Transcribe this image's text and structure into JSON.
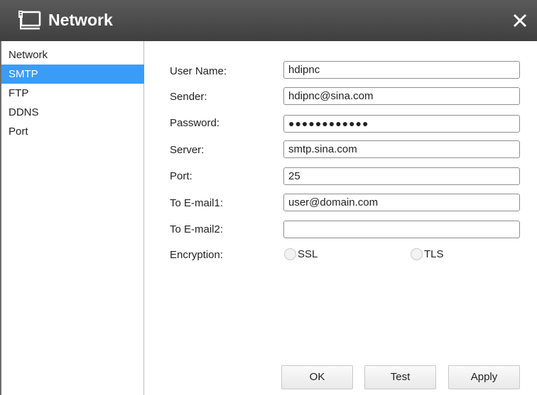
{
  "window": {
    "title": "Network",
    "title_icon": "monitor-network-icon",
    "close_icon": "close-icon",
    "titlebar_color": "#4a4a4a"
  },
  "sidebar": {
    "items": [
      {
        "label": "Network",
        "active": false
      },
      {
        "label": "SMTP",
        "active": true
      },
      {
        "label": "FTP",
        "active": false
      },
      {
        "label": "DDNS",
        "active": false
      },
      {
        "label": "Port",
        "active": false
      }
    ],
    "active_color": "#3b9cf7"
  },
  "form": {
    "user_name": {
      "label": "User Name:",
      "value": "hdipnc"
    },
    "sender": {
      "label": "Sender:",
      "value": "hdipnc@sina.com"
    },
    "password": {
      "label": "Password:",
      "value": "●●●●●●●●●●●●"
    },
    "server": {
      "label": "Server:",
      "value": "smtp.sina.com"
    },
    "port": {
      "label": "Port:",
      "value": "25"
    },
    "to_email1": {
      "label": "To E-mail1:",
      "value": "user@domain.com"
    },
    "to_email2": {
      "label": "To E-mail2:",
      "value": ""
    },
    "encryption": {
      "label": "Encryption:",
      "options": [
        "SSL",
        "TLS"
      ],
      "selected": null
    }
  },
  "buttons": {
    "ok": "OK",
    "test": "Test",
    "apply": "Apply"
  }
}
